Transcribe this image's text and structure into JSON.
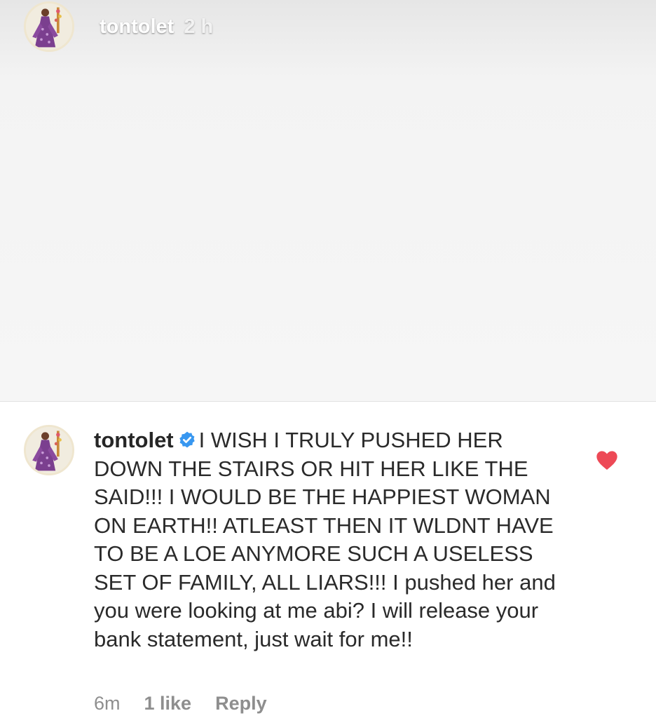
{
  "story": {
    "username": "tontolet",
    "timestamp": "2 h",
    "avatar_icon": "profile-photo-icon"
  },
  "comment": {
    "username": "tontolet",
    "verified_icon": "verified-badge-icon",
    "text": "I WISH I TRULY PUSHED HER DOWN THE STAIRS OR HIT HER LIKE THE SAID!!! I WOULD BE THE HAPPIEST WOMAN ON EARTH!! ATLEAST THEN IT WLDNT HAVE TO BE A LOE ANYMORE SUCH A USELESS SET OF FAMILY, ALL LIARS!!! I pushed her and you were looking at me abi? I will release your bank statement, just wait for me!!",
    "liked": true,
    "like_icon": "heart-icon",
    "age": "6m",
    "likes_label": "1 like",
    "reply_label": "Reply"
  },
  "colors": {
    "heart": "#ed4956",
    "verified": "#3897f0",
    "meta_text": "#8e8e8e",
    "body_text": "#262626"
  }
}
